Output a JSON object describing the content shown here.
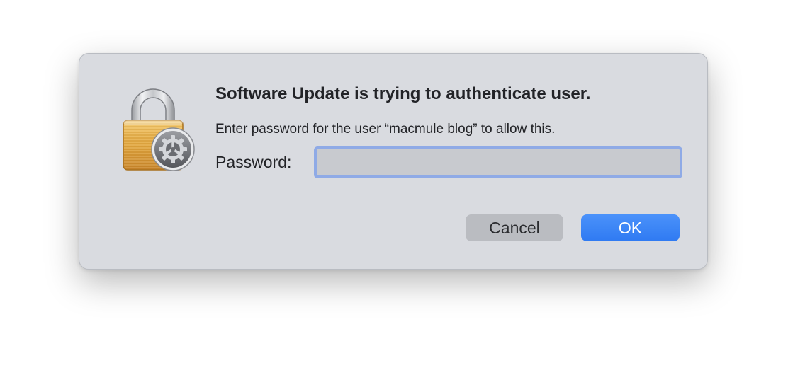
{
  "dialog": {
    "title": "Software Update is trying to authenticate user.",
    "message": "Enter password for the user “macmule blog” to allow this.",
    "password_label": "Password:",
    "password_value": "",
    "cancel_label": "Cancel",
    "ok_label": "OK",
    "icon": "lock-with-gear-icon"
  },
  "colors": {
    "dialog_bg": "#d9dbe0",
    "accent": "#3b86f7",
    "input_focus_ring": "#8faae6",
    "cancel_button_bg": "#babcc1"
  }
}
